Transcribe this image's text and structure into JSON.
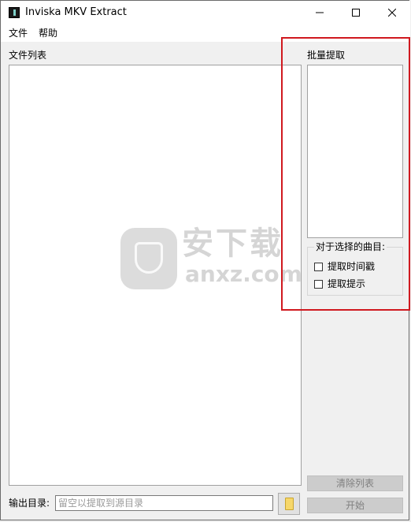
{
  "window": {
    "title": "Inviska MKV Extract"
  },
  "menu": {
    "file": "文件",
    "help": "帮助"
  },
  "file_list": {
    "label": "文件列表"
  },
  "batch": {
    "label": "批量提取"
  },
  "track_group": {
    "title": "对于选择的曲目:",
    "extract_timestamps": {
      "label": "提取时间戳",
      "checked": false
    },
    "extract_cues": {
      "label": "提取提示",
      "checked": false
    }
  },
  "output": {
    "label": "输出目录:",
    "placeholder": "留空以提取到源目录",
    "value": ""
  },
  "buttons": {
    "clear_list": "清除列表",
    "start": "开始"
  },
  "watermark": {
    "text": "安下载",
    "domain": "anxz.com"
  },
  "colors": {
    "highlight_border": "#d0191f",
    "disabled_button": "#cccccc",
    "window_bg": "#f0f0f0"
  }
}
